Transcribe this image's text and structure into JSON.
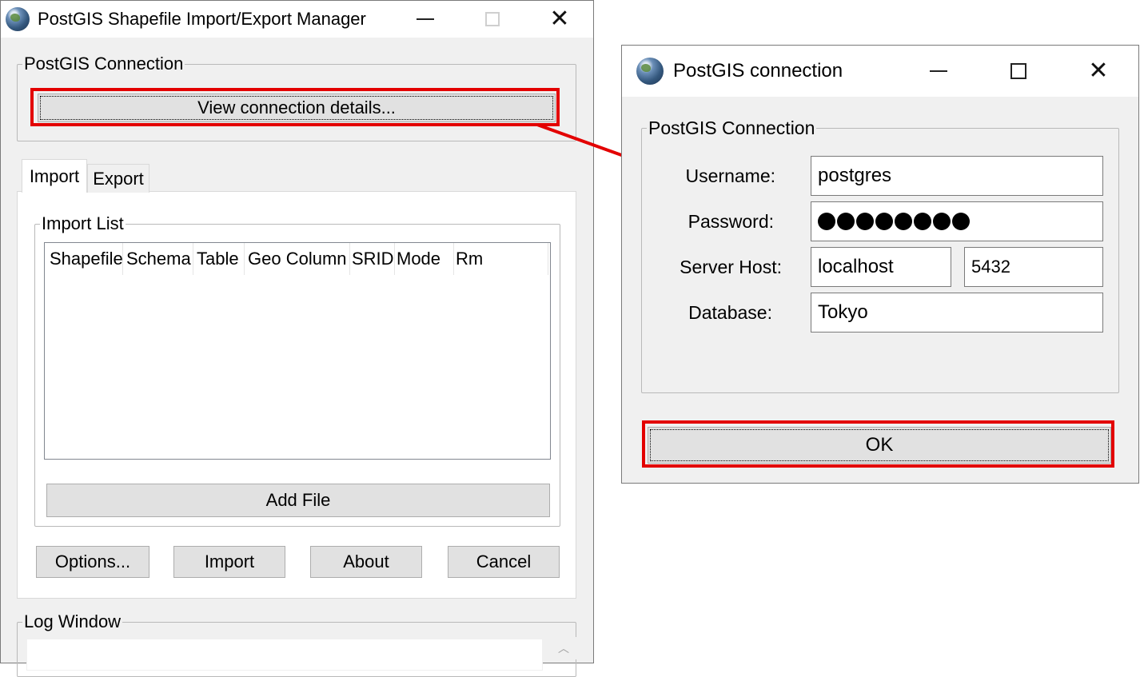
{
  "main_window": {
    "title": "PostGIS Shapefile Import/Export Manager",
    "connection_group": {
      "legend": "PostGIS Connection",
      "view_details_button": "View connection details..."
    },
    "tabs": [
      {
        "label": "Import",
        "active": true
      },
      {
        "label": "Export",
        "active": false
      }
    ],
    "import_list": {
      "legend": "Import List",
      "columns": [
        "Shapefile",
        "Schema",
        "Table",
        "Geo Column",
        "SRID",
        "Mode",
        "Rm"
      ],
      "add_file_button": "Add File"
    },
    "action_buttons": {
      "options": "Options...",
      "import": "Import",
      "about": "About",
      "cancel": "Cancel"
    },
    "log_window": {
      "legend": "Log Window"
    }
  },
  "connection_dialog": {
    "title": "PostGIS connection",
    "group_legend": "PostGIS Connection",
    "username_label": "Username:",
    "username": "postgres",
    "password_label": "Password:",
    "password_mask_count": 8,
    "host_label": "Server Host:",
    "host": "localhost",
    "port": "5432",
    "database_label": "Database:",
    "database": "Tokyo",
    "ok_button": "OK"
  },
  "colors": {
    "highlight_box": "#e30000",
    "arrow": "#e30000",
    "window_background": "#f0f0f0"
  },
  "icons": [
    "postgis-globe-icon",
    "minimize-icon",
    "maximize-icon",
    "close-icon",
    "scroll-up-arrow-icon"
  ]
}
